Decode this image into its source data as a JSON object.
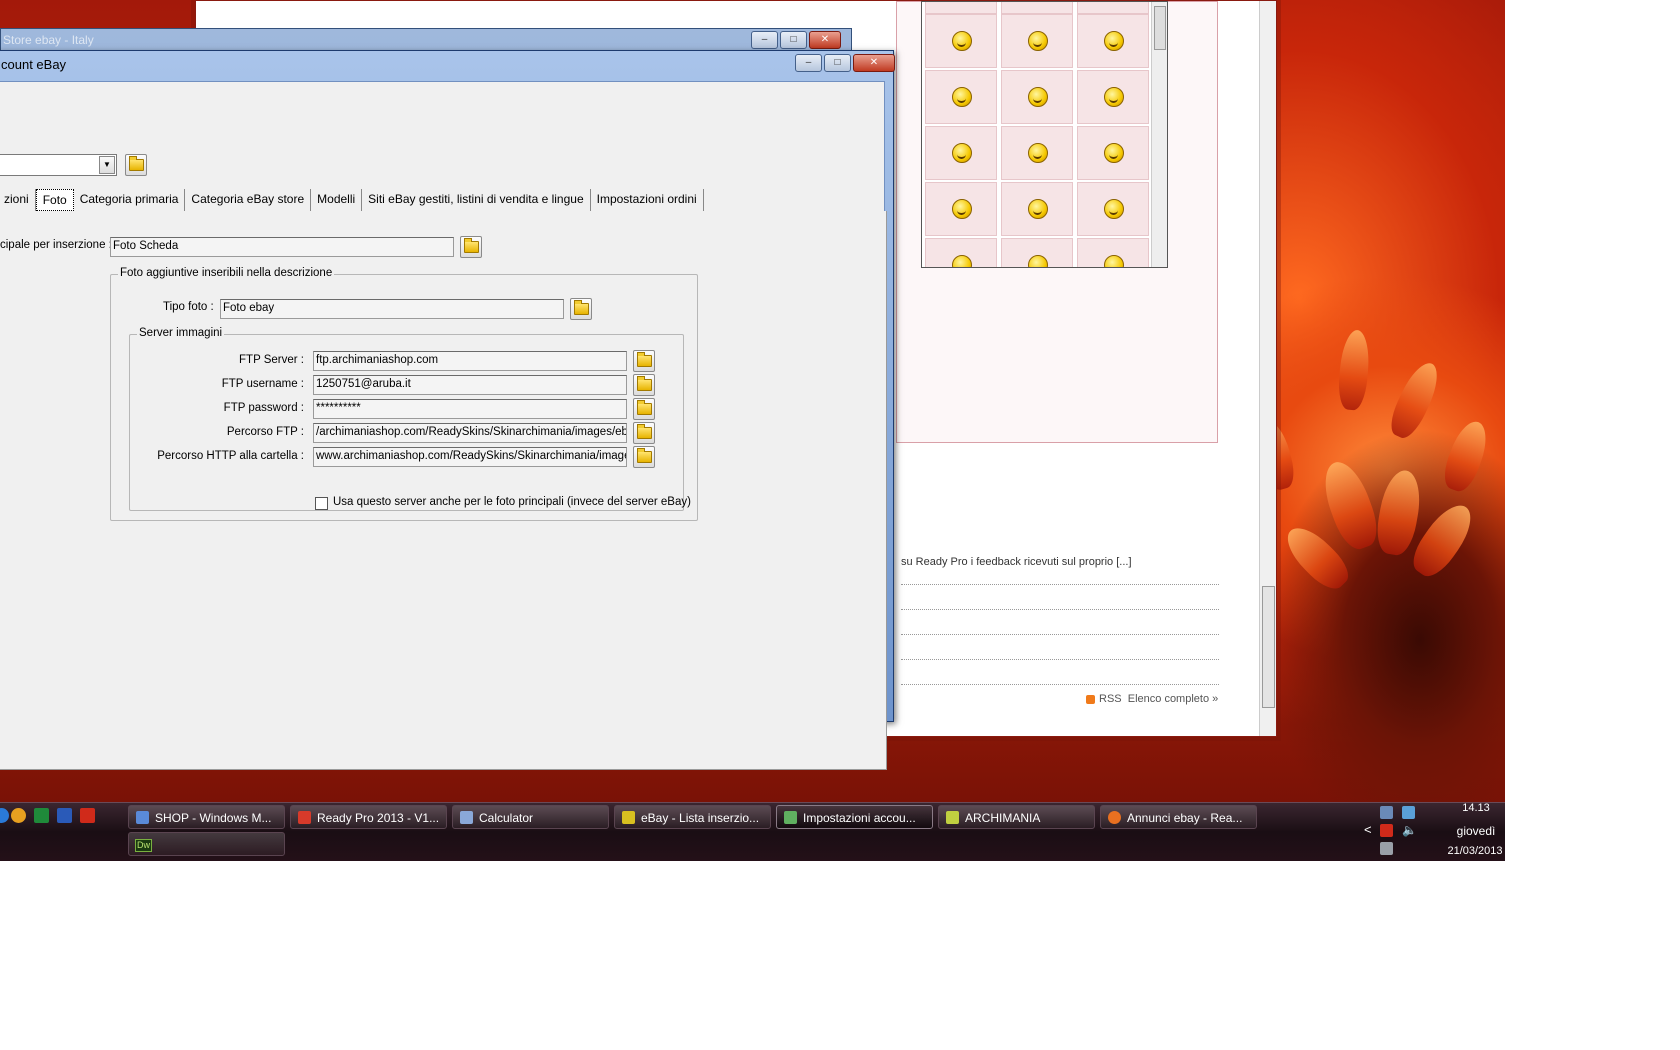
{
  "windows": {
    "middle_title": "Store ebay - Italy",
    "dialog_title": "count eBay"
  },
  "dialog": {
    "tabs": [
      "zioni",
      "Foto",
      "Categoria primaria",
      "Categoria eBay store",
      "Modelli",
      "Siti eBay gestiti, listini di vendita e lingue",
      "Impostazioni ordini"
    ],
    "active_tab": "Foto",
    "main_photo_label": "cipale per inserzione :",
    "main_photo_value": "Foto Scheda",
    "extra_group_title": "Foto aggiuntive inseribili nella descrizione",
    "photo_type_label": "Tipo foto :",
    "photo_type_value": "Foto ebay",
    "server_group_title": "Server immagini",
    "ftp_server_label": "FTP Server :",
    "ftp_server_value": "ftp.archimaniashop.com",
    "ftp_username_label": "FTP username :",
    "ftp_username_value": "1250751@aruba.it",
    "ftp_password_label": "FTP password :",
    "ftp_password_value": "**********",
    "ftp_path_label": "Percorso FTP :",
    "ftp_path_value": "/archimaniashop.com/ReadySkins/Skinarchimania/images/ebay",
    "http_path_label": "Percorso HTTP alla cartella :",
    "http_path_value": "www.archimaniashop.com/ReadySkins/Skinarchimania/images/",
    "checkbox_label": "Usa questo server anche per le foto principali (invece del server eBay)",
    "checkbox_checked": false
  },
  "browser": {
    "feed_text": "su Ready Pro i feedback ricevuti sul proprio [...]",
    "rss_label": "RSS",
    "full_list_label": "Elenco completo »"
  },
  "taskbar": {
    "items": [
      {
        "label": "SHOP - Windows M...",
        "icon": "mail-icon",
        "color": "#5a8ad8"
      },
      {
        "label": "Ready Pro 2013 - V1...",
        "icon": "readypro-icon",
        "color": "#d83a2a"
      },
      {
        "label": "Calculator",
        "icon": "calculator-icon",
        "color": "#8aa8d8"
      },
      {
        "label": "eBay - Lista inserzio...",
        "icon": "ebay-box-icon",
        "color": "#d8c020"
      },
      {
        "label": "Impostazioni accou...",
        "icon": "settings-icon",
        "color": "#60b060"
      },
      {
        "label": "ARCHIMANIA",
        "icon": "archimania-icon",
        "color": "#c0d040"
      },
      {
        "label": "Annunci ebay - Rea...",
        "icon": "firefox-icon",
        "color": "#e87020"
      }
    ],
    "second_row_item": {
      "label": "Dw",
      "icon": "dreamweaver-icon"
    },
    "clock_time": "14.13",
    "clock_day": "giovedì",
    "clock_date": "21/03/2013",
    "tray_chevron": "<"
  },
  "colors": {
    "taskbar_bg": "#1a0e14",
    "dialog_frame": "#6d93cc",
    "wallpaper": "#c42a0c"
  }
}
